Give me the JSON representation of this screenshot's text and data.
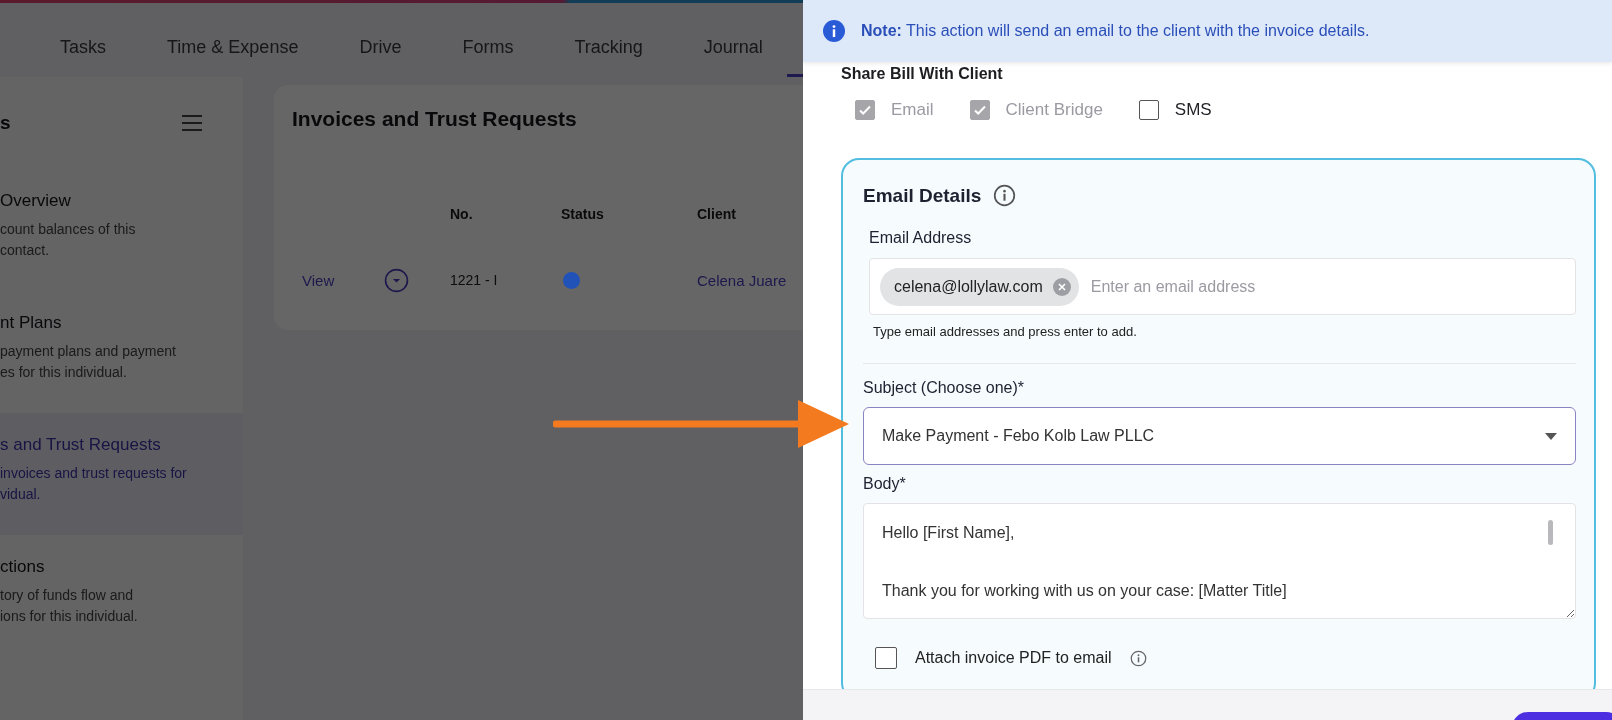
{
  "tabs": [
    {
      "label": "Tasks"
    },
    {
      "label": "Time & Expense"
    },
    {
      "label": "Drive"
    },
    {
      "label": "Forms"
    },
    {
      "label": "Tracking"
    },
    {
      "label": "Journal"
    }
  ],
  "sidebar": {
    "title": "s",
    "items": [
      {
        "title": "Overview",
        "description": "count balances of this\ncontact.",
        "selected": false
      },
      {
        "title": "nt Plans",
        "description": "payment plans and payment\nes for this individual.",
        "selected": false
      },
      {
        "title": "s and Trust Requests",
        "description": "invoices and trust requests for\nvidual.",
        "selected": true
      },
      {
        "title": "ctions",
        "description": "tory of funds flow and\nions for this individual.",
        "selected": false
      }
    ]
  },
  "invoices": {
    "title": "Invoices and Trust Requests",
    "columns": [
      "No.",
      "Status",
      "Client"
    ],
    "rows": [
      {
        "action": "View",
        "number": "1221 - I",
        "color": "#2152b8",
        "client": "Celena Juare"
      }
    ]
  },
  "drawer": {
    "note": "**Note:** This action will send an email to the client with the invoice details.",
    "share_label": "Share Bill With Client",
    "share_options": [
      {
        "label": "Email",
        "checked": true,
        "disabled": true
      },
      {
        "label": "Client Bridge",
        "checked": true,
        "disabled": true
      },
      {
        "label": "SMS",
        "checked": false,
        "disabled": false
      }
    ],
    "email_details": {
      "title": "Email Details",
      "address_label": "Email Address",
      "recipients": [
        "celena@lollylaw.com"
      ],
      "address_placeholder": "Enter an email address",
      "address_hint": "Type email addresses and press enter to add.",
      "subject_label": "Subject (Choose one)*",
      "subject_value": "Make Payment - Febo Kolb Law PLLC",
      "body_label": "Body*",
      "body_value": "Hello [First Name],\n\nThank you for working with us on your case: [Matter Title]",
      "attach_pdf": {
        "label": "Attach invoice PDF to email",
        "checked": false
      }
    }
  }
}
